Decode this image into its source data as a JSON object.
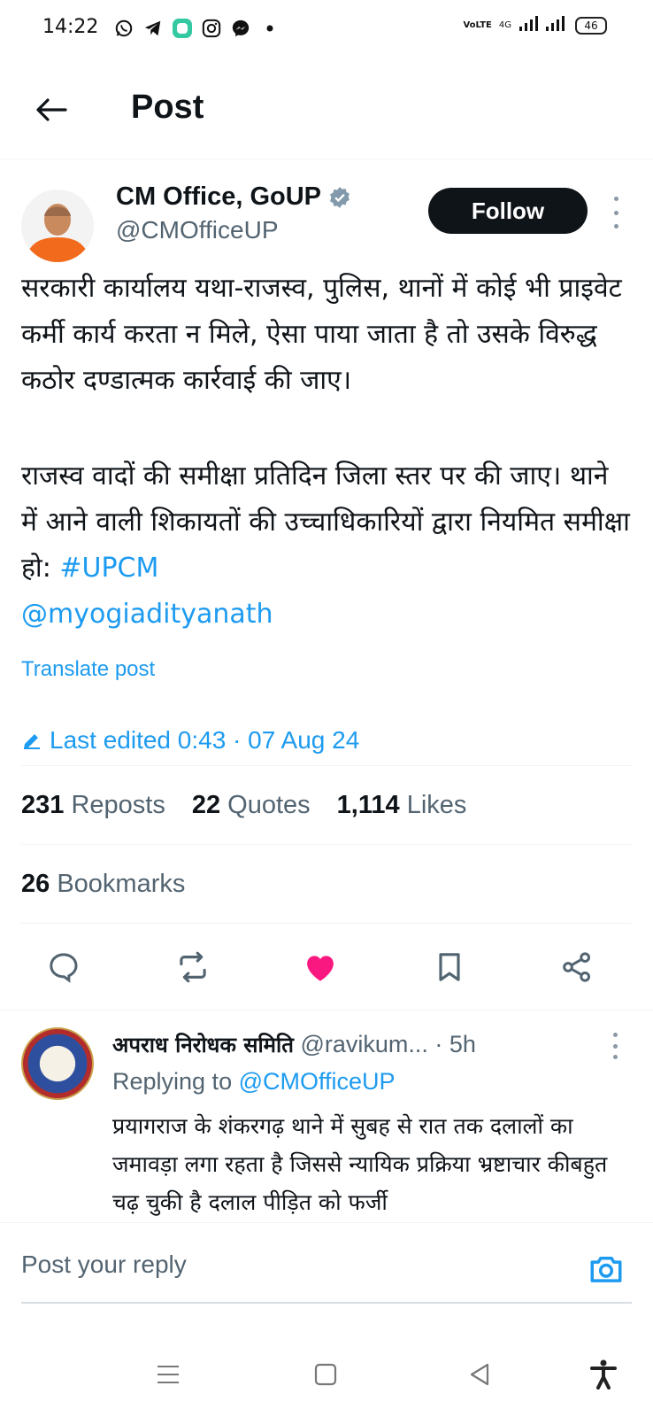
{
  "status_bar": {
    "time": "14:22",
    "app_icons": [
      "whatsapp-icon",
      "telegram-icon",
      "app-icon",
      "instagram-icon",
      "messenger-icon",
      "dot-icon"
    ],
    "network_label": "VoLTE",
    "network_type": "4G",
    "battery": "46"
  },
  "header": {
    "title": "Post"
  },
  "post": {
    "author_name": "CM Office, GoUP",
    "author_handle": "@CMOfficeUP",
    "follow_label": "Follow",
    "paragraph1": "सरकारी कार्यालय यथा-राजस्व, पुलिस, थानों में कोई भी प्राइवेट कर्मी कार्य करता न मिले, ऐसा पाया जाता है तो उसके विरुद्ध कठोर दण्डात्मक कार्रवाई की जाए।",
    "paragraph2": "राजस्व वादों की समीक्षा प्रतिदिन जिला स्तर पर की जाए। थाने में आने वाली शिकायतों की उच्चाधिकारियों द्वारा नियमित समीक्षा हो:",
    "hashtag": "#UPCM",
    "mention": "@myogiadityanath",
    "translate_label": "Translate post",
    "edited_label": "Last edited 0:43 · 07 Aug 24"
  },
  "stats": {
    "reposts_count": "231",
    "reposts_label": "Reposts",
    "quotes_count": "22",
    "quotes_label": "Quotes",
    "likes_count": "1,114",
    "likes_label": "Likes",
    "bookmarks_count": "26",
    "bookmarks_label": "Bookmarks"
  },
  "reply": {
    "name": "अपराध निरोधक समिति",
    "handle": "@ravikum...",
    "time": "· 5h",
    "replying_prefix": "Replying to",
    "replying_handle": "@CMOfficeUP",
    "text": "प्रयागराज के शंकरगढ़ थाने में सुबह से रात तक दलालों का जमावड़ा लगा रहता है जिससे न्यायिक प्रक्रिया भ्रष्टाचार कीबहुत चढ़ चुकी है दलाल पीड़ित को फर्जी"
  },
  "compose": {
    "placeholder": "Post your reply"
  },
  "colors": {
    "accent": "#1d9bf0",
    "like": "#f91880",
    "text": "#0f1419",
    "muted": "#536471"
  }
}
